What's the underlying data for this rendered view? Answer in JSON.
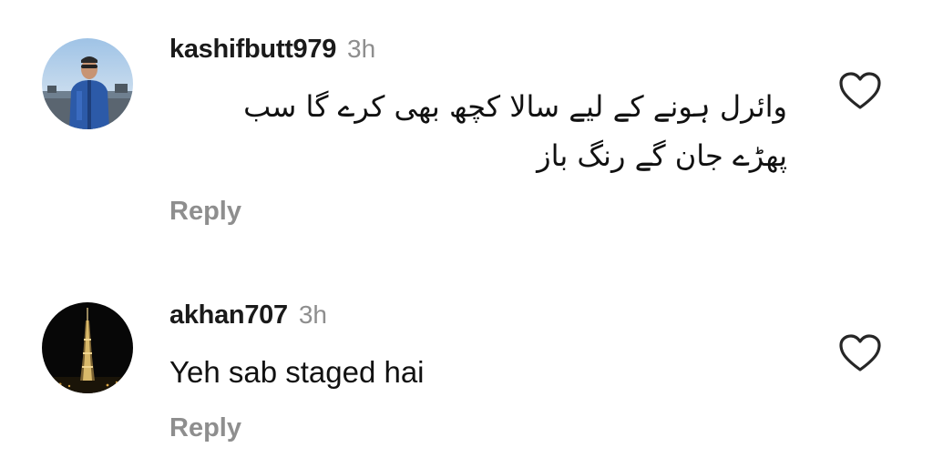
{
  "comments": [
    {
      "username": "kashifbutt979",
      "time": "3h",
      "text_line1": "وائرل ہونے کے لیے سالا کچھ بھی کرے گا سب",
      "text_line2": "پھڑے جان گے رنگ باز",
      "reply_label": "Reply",
      "avatar_icon": "avatar-man-blue-jacket",
      "like_icon": "heart-outline-icon"
    },
    {
      "username": "akhan707",
      "time": "3h",
      "text": "Yeh sab staged hai",
      "reply_label": "Reply",
      "avatar_icon": "avatar-night-tower",
      "like_icon": "heart-outline-icon"
    }
  ],
  "colors": {
    "text": "#111111",
    "muted": "#8e8e8e"
  }
}
